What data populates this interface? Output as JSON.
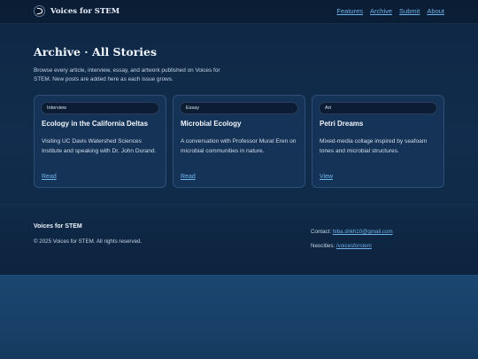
{
  "header": {
    "brand_name": "Voices for STEM",
    "logo_icon": "logo-icon",
    "nav": [
      "Features",
      "Archive",
      "Submit",
      "About"
    ]
  },
  "main": {
    "title": "Archive · All Stories",
    "intro": "Browse every article, interview, essay, and artwork published on Voices for STEM. New posts are added here as each issue grows."
  },
  "cards": [
    {
      "tag": "Interview",
      "title": "Ecology in the California Deltas",
      "description": "Visiting UC Davis Watershed Sciences Institute and speaking with Dr. John Durand.",
      "link": "Read"
    },
    {
      "tag": "Essay",
      "title": "Microbial Ecology",
      "description": "A conversation with Professor Murat Eren on microbial communities in nature.",
      "link": "Read"
    },
    {
      "tag": "Art",
      "title": "Petri Dreams",
      "description": "Mixed-media collage inspired by seafoam tones and microbial structures.",
      "link": "View"
    }
  ],
  "footer": {
    "brand": "Voices for STEM",
    "copyright": "© 2025 Voices for STEM. All rights reserved.",
    "contact_label": "Contact:",
    "contact_email": "hiba.shkh10@gmail.com",
    "social_label": "Neocities:",
    "social_link": "/voicesforstem"
  },
  "colors": {
    "accent_link": "#6fb2ea",
    "background": "#112c4c",
    "card_bg": "#183a60"
  }
}
